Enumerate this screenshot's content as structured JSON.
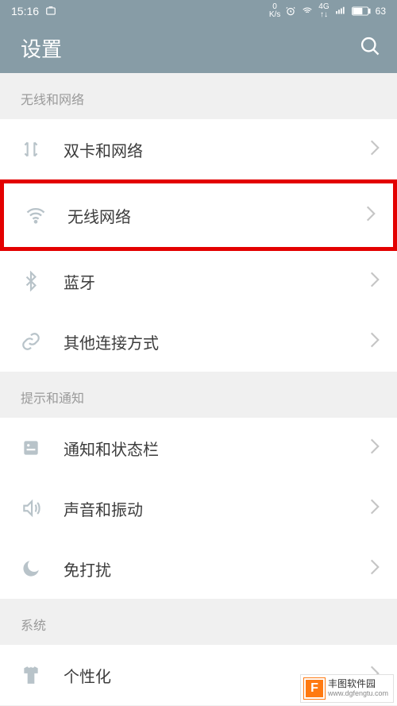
{
  "statusbar": {
    "time": "15:16",
    "net_speed_top": "0",
    "net_speed_bot": "K/s",
    "net_type": "4G",
    "battery": "63"
  },
  "appbar": {
    "title": "设置"
  },
  "sections": {
    "wireless": {
      "header": "无线和网络"
    },
    "notify": {
      "header": "提示和通知"
    },
    "system": {
      "header": "系统"
    }
  },
  "items": {
    "dualsim": {
      "label": "双卡和网络"
    },
    "wifi": {
      "label": "无线网络"
    },
    "bluetooth": {
      "label": "蓝牙"
    },
    "otherconn": {
      "label": "其他连接方式"
    },
    "notif": {
      "label": "通知和状态栏"
    },
    "sound": {
      "label": "声音和振动"
    },
    "dnd": {
      "label": "免打扰"
    },
    "personal": {
      "label": "个性化"
    }
  },
  "watermark": {
    "logo": "F",
    "name": "丰图软件园",
    "url": "www.dgfengtu.com"
  }
}
